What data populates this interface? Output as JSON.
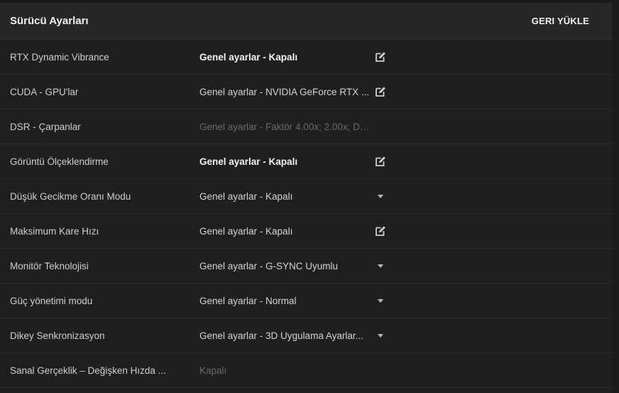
{
  "header": {
    "title": "Sürücü Ayarları",
    "reset_label": "GERI YÜKLE"
  },
  "rows": [
    {
      "label": "RTX Dynamic Vibrance",
      "value": "Genel ayarlar - Kapalı",
      "control": "edit-icon",
      "style": "bold"
    },
    {
      "label": "CUDA - GPU'lar",
      "value": "Genel ayarlar - NVIDIA GeForce RTX ...",
      "control": "edit-icon",
      "style": "normal"
    },
    {
      "label": "DSR - Çarpanlar",
      "value": "Genel ayarlar - Faktör 4.00x; 2.00x; Dü...",
      "control": "none",
      "style": "dim"
    },
    {
      "label": "Görüntü Ölçeklendirme",
      "value": "Genel ayarlar - Kapalı",
      "control": "edit-icon",
      "style": "bold"
    },
    {
      "label": "Düşük Gecikme Oranı Modu",
      "value": "Genel ayarlar - Kapalı",
      "control": "chevron-down-icon",
      "style": "normal"
    },
    {
      "label": "Maksimum Kare Hızı",
      "value": "Genel ayarlar - Kapalı",
      "control": "edit-icon",
      "style": "normal"
    },
    {
      "label": "Monitör Teknolojisi",
      "value": "Genel ayarlar - G-SYNC Uyumlu",
      "control": "chevron-down-icon",
      "style": "normal"
    },
    {
      "label": "Güç yönetimi modu",
      "value": "Genel ayarlar - Normal",
      "control": "chevron-down-icon",
      "style": "normal"
    },
    {
      "label": "Dikey Senkronizasyon",
      "value": "Genel ayarlar - 3D Uygulama Ayarlar...",
      "control": "chevron-down-icon",
      "style": "normal"
    },
    {
      "label": "Sanal Gerçeklik – Değişken Hızda ...",
      "value": "Kapalı",
      "control": "none",
      "style": "dim"
    }
  ]
}
